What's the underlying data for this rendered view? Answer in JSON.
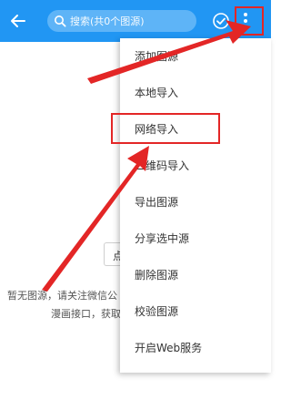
{
  "toolbar": {
    "search_placeholder": "搜索(共0个图源)",
    "icons": {
      "back": "arrow-left-icon",
      "search": "search-icon",
      "select": "check-circle-icon",
      "more": "more-vert-icon"
    }
  },
  "empty_state": {
    "button_partial": "点",
    "line1": "暂无图源，请关注微信公",
    "line2": "漫画接口，获取"
  },
  "menu": {
    "items": [
      {
        "label": "添加图源"
      },
      {
        "label": "本地导入"
      },
      {
        "label": "网络导入"
      },
      {
        "label": "二维码导入"
      },
      {
        "label": "导出图源"
      },
      {
        "label": "分享选中源"
      },
      {
        "label": "删除图源"
      },
      {
        "label": "校验图源"
      },
      {
        "label": "开启Web服务"
      }
    ]
  },
  "colors": {
    "appbar": "#2196f3",
    "annotation": "#e32626"
  }
}
